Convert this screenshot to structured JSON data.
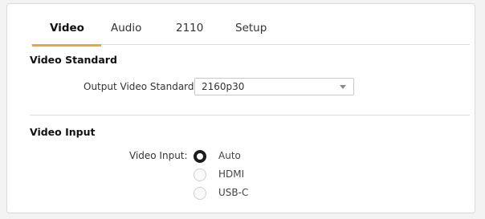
{
  "tabs": [
    {
      "label": "Video",
      "active": true
    },
    {
      "label": "Audio",
      "active": false
    },
    {
      "label": "2110",
      "active": false
    },
    {
      "label": "Setup",
      "active": false
    }
  ],
  "accent_color": "#f2a33a",
  "video_standard": {
    "title": "Video Standard",
    "output_label": "Output Video Standard:",
    "output_value": "2160p30"
  },
  "video_input": {
    "title": "Video Input",
    "label": "Video Input:",
    "options": [
      {
        "label": "Auto",
        "selected": true
      },
      {
        "label": "HDMI",
        "selected": false
      },
      {
        "label": "USB-C",
        "selected": false
      }
    ]
  }
}
